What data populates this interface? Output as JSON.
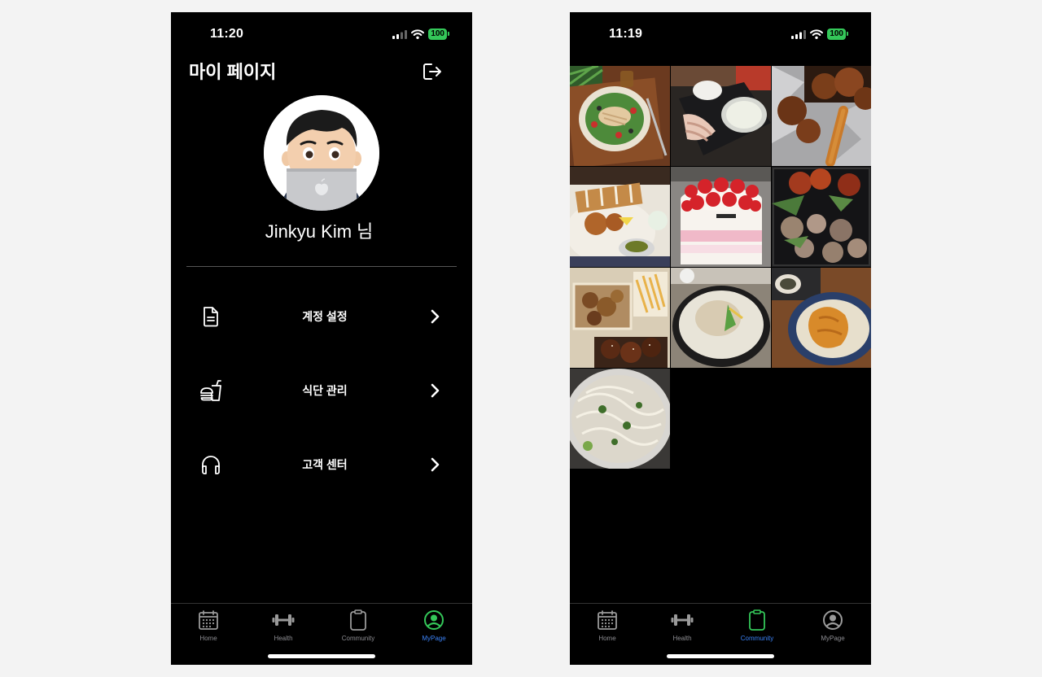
{
  "left_screen": {
    "status": {
      "time": "11:20",
      "battery": "100"
    },
    "title": "마이 페이지",
    "user": {
      "name": "Jinkyu Kim",
      "suffix": "님"
    },
    "menu": [
      {
        "label": "계정 설정",
        "icon": "document-icon"
      },
      {
        "label": "식단 관리",
        "icon": "food-icon"
      },
      {
        "label": "고객 센터",
        "icon": "headphones-icon"
      }
    ],
    "tabs": [
      {
        "label": "Home",
        "icon": "calendar-icon"
      },
      {
        "label": "Health",
        "icon": "dumbbell-icon"
      },
      {
        "label": "Community",
        "icon": "clipboard-icon"
      },
      {
        "label": "MyPage",
        "icon": "profile-icon"
      }
    ],
    "active_tab": "MyPage"
  },
  "right_screen": {
    "status": {
      "time": "11:19",
      "battery": "100"
    },
    "photos": [
      "salad-photo",
      "sliced-meat-photo",
      "fried-chicken-photo",
      "tonkatsu-photo",
      "strawberry-cake-photo",
      "grilled-meat-photo",
      "boxed-chicken-photo",
      "samgyetang-photo",
      "spicy-chicken-photo",
      "noodle-soup-photo"
    ],
    "tabs": [
      {
        "label": "Home",
        "icon": "calendar-icon"
      },
      {
        "label": "Health",
        "icon": "dumbbell-icon"
      },
      {
        "label": "Community",
        "icon": "clipboard-icon"
      },
      {
        "label": "MyPage",
        "icon": "profile-icon"
      }
    ],
    "active_tab": "Community"
  },
  "colors": {
    "accent_green": "#34c759",
    "active_label": "#3b82f6",
    "inactive_label": "#8e8e93"
  }
}
